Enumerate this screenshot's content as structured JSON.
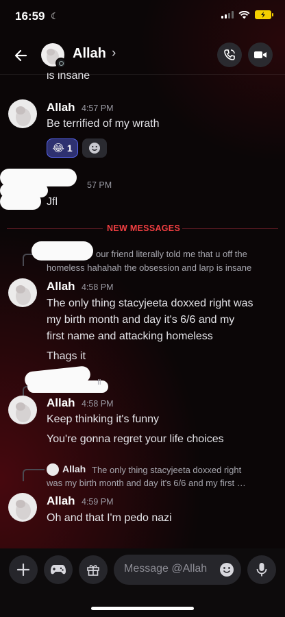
{
  "status_bar": {
    "time": "16:59"
  },
  "header": {
    "name": "Allah"
  },
  "messages": {
    "top_partial": "is insane",
    "m1": {
      "user": "Allah",
      "time": "4:57 PM",
      "text": "Be terrified of my wrath",
      "reaction_count": "1"
    },
    "m2": {
      "time": "57 PM",
      "text": "Jfl"
    },
    "new_messages_label": "NEW MESSAGES",
    "m3": {
      "reply_line1": "our friend literally told me that u off the",
      "reply_line2": "homeless hahahah the obsession and larp is insane",
      "user": "Allah",
      "time": "4:58 PM",
      "lines": [
        "The only thing stacyjeeta doxxed right was",
        "my birth month and day it's 6/6 and my",
        "first name and attacking homeless"
      ],
      "text2": "Thags it"
    },
    "m4": {
      "reply_snippet": "fl",
      "user": "Allah",
      "time": "4:58 PM",
      "text1": "Keep thinking it's funny",
      "text2": "You're gonna regret your life choices"
    },
    "m5": {
      "reply_user": "Allah",
      "reply_line1": "The only thing stacyjeeta doxxed right",
      "reply_line2": "was my birth month and day it's 6/6 and my first …",
      "user": "Allah",
      "time": "4:59 PM",
      "text": "Oh and that I'm pedo nazi"
    }
  },
  "composer": {
    "placeholder": "Message @Allah"
  },
  "colors": {
    "accent_red": "#f23f42",
    "background": "#0b0607",
    "reaction_highlight": "#3a3f8f"
  }
}
